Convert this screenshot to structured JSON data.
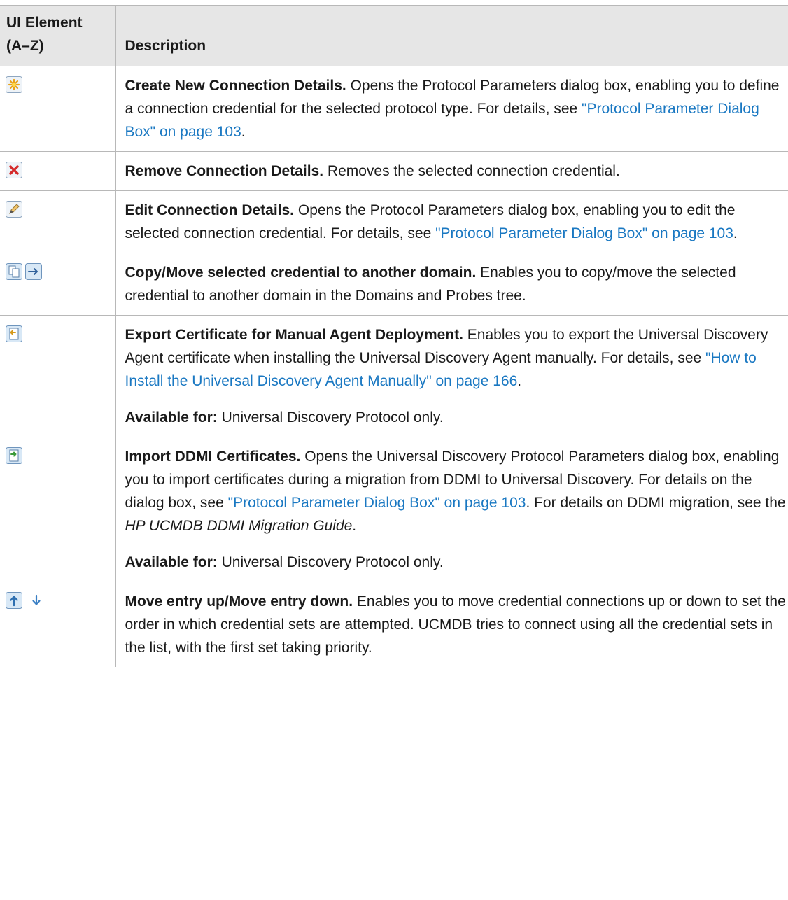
{
  "header": {
    "col_element": "UI Element (A–Z)",
    "col_description": "Description"
  },
  "rows": [
    {
      "icon": "new-star-icon",
      "title": "Create New Connection Details.",
      "text1": " Opens the Protocol Parameters dialog box, enabling you to define a connection credential for the selected protocol type. For details, see ",
      "link1": "\"Protocol Parameter Dialog Box\" on page 103",
      "text2": "."
    },
    {
      "icon": "remove-x-icon",
      "title": "Remove Connection Details.",
      "text1": " Removes the selected connection credential."
    },
    {
      "icon": "edit-pencil-icon",
      "title": "Edit Connection Details.",
      "text1": " Opens the Protocol Parameters dialog box, enabling you to edit the selected connection credential. For details, see ",
      "link1": "\"Protocol Parameter Dialog Box\" on page 103",
      "text2": "."
    },
    {
      "icons": [
        "copy-icon",
        "move-arrow-icon"
      ],
      "title": "Copy/Move selected credential to another domain.",
      "text1": " Enables you to copy/move the selected credential to another domain in the Domains and Probes tree."
    },
    {
      "icon": "export-certificate-icon",
      "title": "Export Certificate for Manual Agent Deployment.",
      "text1": " Enables you to export the Universal Discovery Agent certificate when installing the Universal Discovery Agent manually. For details, see ",
      "link1": "\"How to Install the Universal Discovery Agent Manually\" on page 166",
      "text2": ".",
      "note_label": "Available for:",
      "note_text": " Universal Discovery Protocol only."
    },
    {
      "icon": "import-certificate-icon",
      "title": "Import DDMI Certificates.",
      "text1": " Opens the Universal Discovery Protocol Parameters dialog box, enabling you to import certificates during a migration from DDMI to Universal Discovery. For details on the dialog box, see ",
      "link1": "\"Protocol Parameter Dialog Box\" on page 103",
      "text2": ". For details on DDMI migration, see the ",
      "italic": "HP UCMDB DDMI Migration Guide",
      "text3": ".",
      "note_label": "Available for:",
      "note_text": " Universal Discovery Protocol only."
    },
    {
      "icons": [
        "move-up-icon",
        "move-down-icon"
      ],
      "title": "Move entry up/Move entry down.",
      "text1": " Enables you to move credential connections up or down to set the order in which credential sets are attempted. UCMDB tries to connect using all the credential sets in the list, with the first set taking priority."
    }
  ]
}
